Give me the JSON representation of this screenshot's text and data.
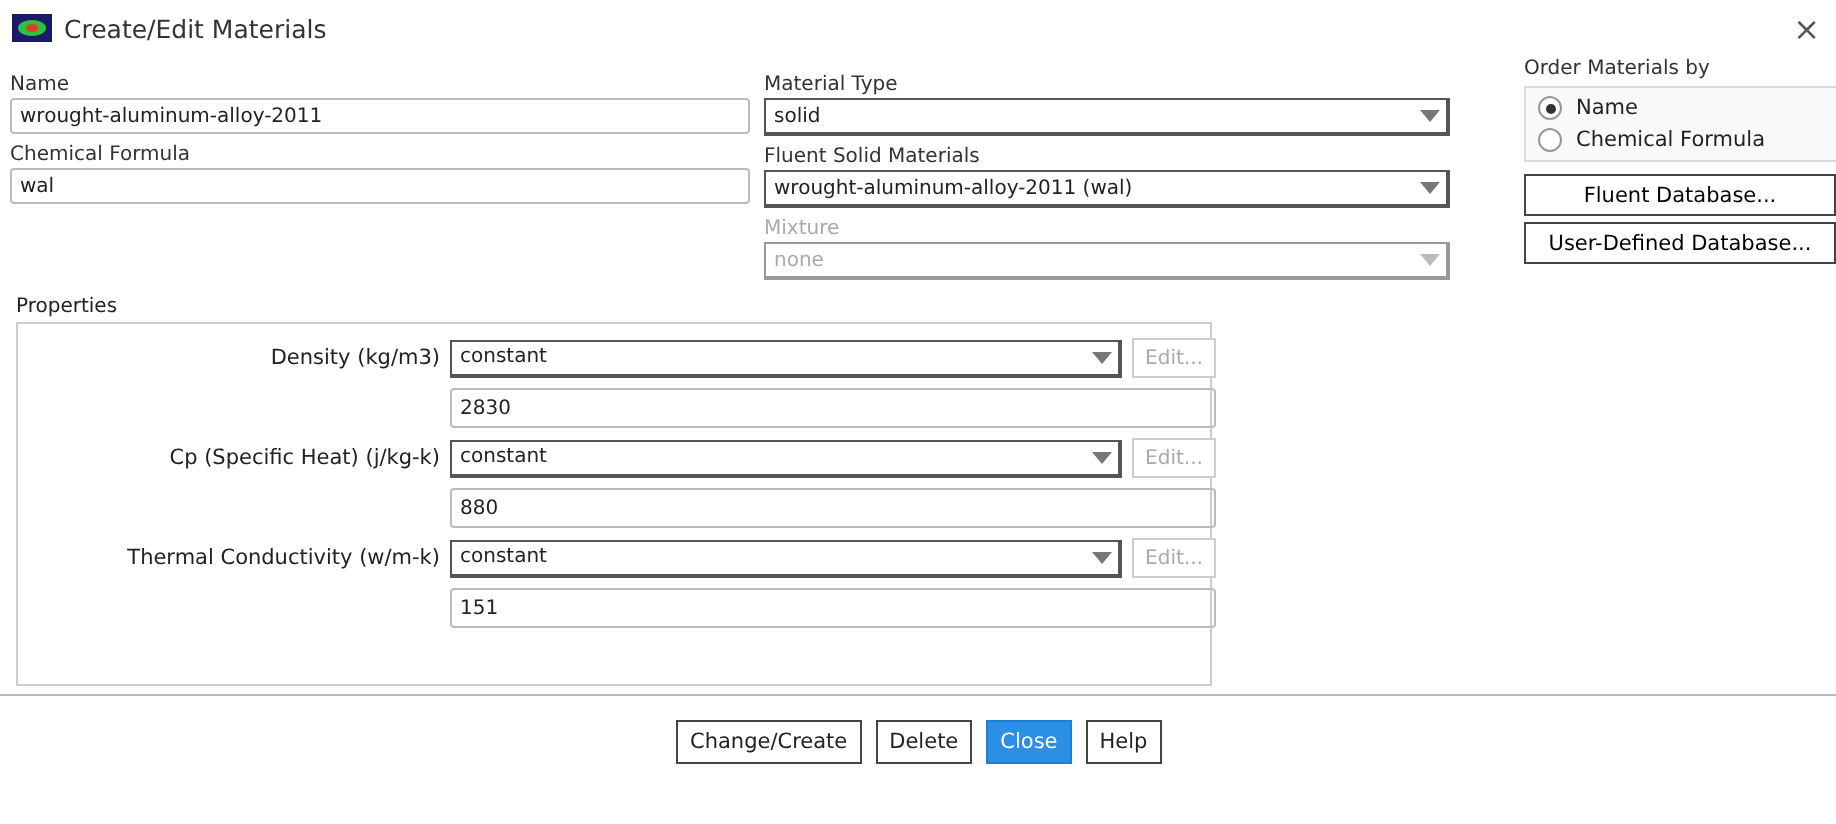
{
  "window": {
    "title": "Create/Edit Materials",
    "close": "×"
  },
  "name": {
    "label": "Name",
    "value": "wrought-aluminum-alloy-2011"
  },
  "chemical_formula": {
    "label": "Chemical Formula",
    "value": "wal"
  },
  "material_type": {
    "label": "Material Type",
    "value": "solid",
    "disabled": false
  },
  "fluent_solid_materials": {
    "label": "Fluent Solid Materials",
    "value": "wrought-aluminum-alloy-2011 (wal)",
    "disabled": false
  },
  "mixture": {
    "label": "Mixture",
    "value": "none",
    "disabled": true
  },
  "order_materials_by": {
    "label": "Order Materials by",
    "options": [
      {
        "label": "Name",
        "selected": true
      },
      {
        "label": "Chemical Formula",
        "selected": false
      }
    ]
  },
  "database_buttons": [
    "Fluent Database...",
    "User-Defined Database..."
  ],
  "properties": {
    "label": "Properties",
    "rows": [
      {
        "label": "Density (kg/m3)",
        "method": "constant",
        "edit": "Edit...",
        "edit_disabled": true,
        "value": "2830"
      },
      {
        "label": "Cp (Specific Heat) (j/kg-k)",
        "method": "constant",
        "edit": "Edit...",
        "edit_disabled": true,
        "value": "880"
      },
      {
        "label": "Thermal Conductivity (w/m-k)",
        "method": "constant",
        "edit": "Edit...",
        "edit_disabled": true,
        "value": "151"
      }
    ]
  },
  "buttons": [
    {
      "label": "Change/Create",
      "primary": false
    },
    {
      "label": "Delete",
      "primary": false
    },
    {
      "label": "Close",
      "primary": true
    },
    {
      "label": "Help",
      "primary": false
    }
  ]
}
